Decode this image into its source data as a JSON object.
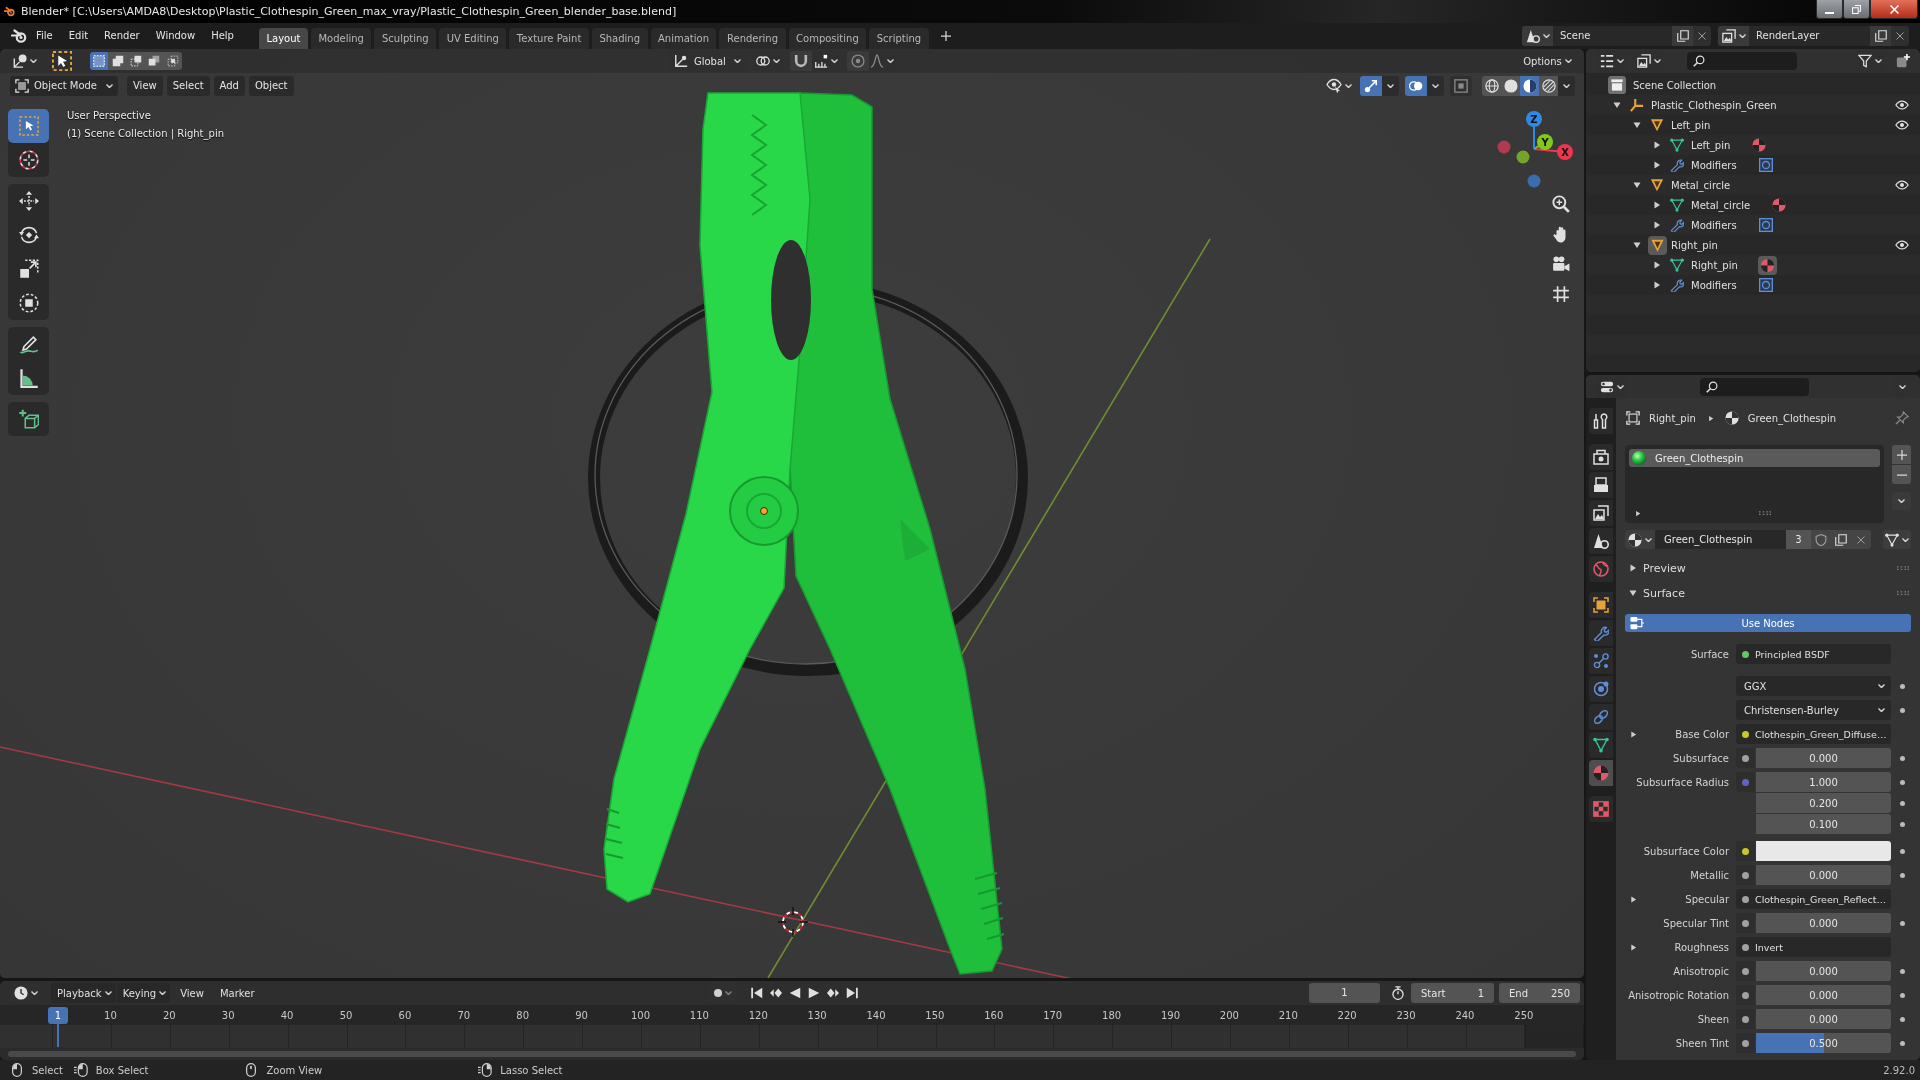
{
  "window": {
    "title": "Blender* [C:\\Users\\AMDA8\\Desktop\\Plastic_Clothespin_Green_max_vray/Plastic_Clothespin_Green_blender_base.blend]"
  },
  "top_bar": {
    "menus": [
      "File",
      "Edit",
      "Render",
      "Window",
      "Help"
    ],
    "workspaces": [
      {
        "label": "Layout",
        "selected": true
      },
      {
        "label": "Modeling",
        "selected": false
      },
      {
        "label": "Sculpting",
        "selected": false
      },
      {
        "label": "UV Editing",
        "selected": false
      },
      {
        "label": "Texture Paint",
        "selected": false
      },
      {
        "label": "Shading",
        "selected": false
      },
      {
        "label": "Animation",
        "selected": false
      },
      {
        "label": "Rendering",
        "selected": false
      },
      {
        "label": "Compositing",
        "selected": false
      },
      {
        "label": "Scripting",
        "selected": false
      }
    ],
    "scene": "Scene",
    "view_layer": "RenderLayer"
  },
  "viewport": {
    "tool_header": {
      "select_modes": [
        {
          "kind": "new",
          "selected": true
        },
        {
          "kind": "extend",
          "selected": false
        },
        {
          "kind": "subtract",
          "selected": false
        },
        {
          "kind": "invert",
          "selected": false
        },
        {
          "kind": "intersect",
          "selected": false
        }
      ],
      "orientation": "Global",
      "snap": {
        "on": false
      },
      "proportional": {
        "on": false
      },
      "options": "Options"
    },
    "header": {
      "mode": "Object Mode",
      "menus": [
        "View",
        "Select",
        "Add",
        "Object"
      ],
      "toggles": [
        {
          "kind": "gizmos",
          "on": true
        },
        {
          "kind": "overlays",
          "on": true
        },
        {
          "kind": "xray",
          "on": false
        }
      ],
      "shading": [
        {
          "kind": "wireframe",
          "selected": false
        },
        {
          "kind": "solid",
          "selected": false
        },
        {
          "kind": "material",
          "selected": true
        },
        {
          "kind": "rendered",
          "selected": false
        }
      ]
    },
    "tool_groups": [
      [
        {
          "kind": "select",
          "selected": true
        },
        {
          "kind": "cursor",
          "selected": false
        }
      ],
      [
        {
          "kind": "move",
          "selected": false
        },
        {
          "kind": "rotate",
          "selected": false
        },
        {
          "kind": "scale",
          "selected": false
        },
        {
          "kind": "transform",
          "selected": false
        }
      ],
      [
        {
          "kind": "annotate",
          "selected": false
        },
        {
          "kind": "measure",
          "selected": false
        }
      ],
      [
        {
          "kind": "add_cube",
          "selected": false
        }
      ]
    ],
    "info": [
      "User Perspective",
      "(1) Scene Collection | Right_pin"
    ],
    "gizmo": {
      "axes": [
        {
          "label": "X",
          "color": "#f0354f"
        },
        {
          "label": "Y",
          "color": "#82c91e"
        },
        {
          "label": "Z",
          "color": "#2f8ae6"
        }
      ],
      "negative_axes": [
        {
          "color": "#b23a50"
        },
        {
          "color": "#74a42a"
        },
        {
          "color": "#3a6cae"
        }
      ]
    }
  },
  "outliner": {
    "items": [
      {
        "name": "Scene Collection",
        "kind": "collection",
        "active": false,
        "children": [
          {
            "name": "Plastic_Clothespin_Green",
            "kind": "empty",
            "expanded": true,
            "visible": true,
            "active": false,
            "children": [
              {
                "name": "Left_pin",
                "kind": "object",
                "expanded": true,
                "visible": true,
                "active": false,
                "children": [
                  {
                    "name": "Left_pin",
                    "kind": "mesh",
                    "expanded": false,
                    "active": false
                  },
                  {
                    "name": "Modifiers",
                    "kind": "modifiers",
                    "expanded": false,
                    "active": false
                  }
                ]
              },
              {
                "name": "Metal_circle",
                "kind": "object",
                "expanded": true,
                "visible": true,
                "active": false,
                "children": [
                  {
                    "name": "Metal_circle",
                    "kind": "mesh",
                    "expanded": false,
                    "active": false
                  },
                  {
                    "name": "Modifiers",
                    "kind": "modifiers",
                    "expanded": false,
                    "active": false
                  }
                ]
              },
              {
                "name": "Right_pin",
                "kind": "object",
                "expanded": true,
                "visible": true,
                "active": true,
                "children": [
                  {
                    "name": "Right_pin",
                    "kind": "mesh",
                    "expanded": false,
                    "active": true
                  },
                  {
                    "name": "Modifiers",
                    "kind": "modifiers",
                    "expanded": false,
                    "active": false
                  }
                ]
              }
            ]
          }
        ]
      }
    ]
  },
  "properties": {
    "tab_groups": [
      [
        {
          "kind": "tool",
          "selected": false
        }
      ],
      [
        {
          "kind": "render",
          "selected": false
        },
        {
          "kind": "output",
          "selected": false
        },
        {
          "kind": "view_layer",
          "selected": false
        },
        {
          "kind": "scene",
          "selected": false
        },
        {
          "kind": "world",
          "selected": false
        }
      ],
      [
        {
          "kind": "object",
          "selected": false
        },
        {
          "kind": "modifiers",
          "selected": false
        },
        {
          "kind": "particles",
          "selected": false
        },
        {
          "kind": "physics",
          "selected": false
        },
        {
          "kind": "constraints",
          "selected": false
        },
        {
          "kind": "data",
          "selected": false
        },
        {
          "kind": "material",
          "selected": true
        }
      ],
      [
        {
          "kind": "texture",
          "selected": false
        }
      ]
    ],
    "breadcrumb": [
      "Right_pin",
      "Green_Clothespin"
    ],
    "material_slots": [
      {
        "name": "Green_Clothespin",
        "selected": true
      }
    ],
    "material": {
      "name": "Green_Clothespin",
      "users": "3"
    },
    "panels": [
      {
        "title": "Preview",
        "expanded": false
      },
      {
        "title": "Surface",
        "expanded": true,
        "use_nodes": {
          "label": "Use Nodes",
          "on": true
        },
        "inputs": [
          {
            "label": "Surface",
            "kind": "link",
            "socket": {
              "color": "#63c763"
            },
            "value": "Principled BSDF"
          },
          {
            "kind": "dropdown",
            "value": "GGX"
          },
          {
            "kind": "dropdown",
            "value": "Christensen-Burley"
          },
          {
            "label": "Base Color",
            "kind": "link",
            "socket": {
              "color": "#c7c729"
            },
            "value": "Clothespin_Green_Diffuse…",
            "expanded": false
          },
          {
            "label": "Subsurface",
            "kind": "slider",
            "socket": {
              "color": "#a1a1a1"
            },
            "value": "0.000",
            "level": 0
          },
          {
            "label": "Subsurface Radius",
            "kind": "vector",
            "socket": {
              "color": "#6363c7"
            },
            "values": [
              "1.000",
              "0.200",
              "0.100"
            ]
          },
          {
            "label": "Subsurface Color",
            "kind": "color",
            "socket": {
              "color": "#c7c729"
            },
            "color": "#e8e8e8"
          },
          {
            "label": "Metallic",
            "kind": "slider",
            "socket": {
              "color": "#a1a1a1"
            },
            "value": "0.000",
            "level": 0
          },
          {
            "label": "Specular",
            "kind": "link",
            "socket": {
              "color": "#a1a1a1"
            },
            "value": "Clothespin_Green_Reflect…",
            "expanded": false
          },
          {
            "label": "Specular Tint",
            "kind": "slider",
            "socket": {
              "color": "#a1a1a1"
            },
            "value": "0.000",
            "level": 0
          },
          {
            "label": "Roughness",
            "kind": "link",
            "socket": {
              "color": "#a1a1a1"
            },
            "value": "Invert",
            "expanded": false
          },
          {
            "label": "Anisotropic",
            "kind": "slider",
            "socket": {
              "color": "#a1a1a1"
            },
            "value": "0.000",
            "level": 0
          },
          {
            "label": "Anisotropic Rotation",
            "kind": "slider",
            "socket": {
              "color": "#a1a1a1"
            },
            "value": "0.000",
            "level": 0
          },
          {
            "label": "Sheen",
            "kind": "slider",
            "socket": {
              "color": "#a1a1a1"
            },
            "value": "0.000",
            "level": 0
          },
          {
            "label": "Sheen Tint",
            "kind": "slider",
            "socket": {
              "color": "#a1a1a1"
            },
            "value": "0.500",
            "level": 0.5
          }
        ]
      }
    ]
  },
  "timeline": {
    "menus": [
      {
        "label": "Playback",
        "kind": "dropdown"
      },
      {
        "label": "Keying",
        "kind": "dropdown"
      },
      {
        "label": "View",
        "kind": "menu"
      },
      {
        "label": "Marker",
        "kind": "menu"
      }
    ],
    "frame": "1",
    "start_label": "Start",
    "start": "1",
    "end_label": "End",
    "end": "250",
    "playhead": "1",
    "ticks": [
      "10",
      "20",
      "30",
      "40",
      "50",
      "60",
      "70",
      "80",
      "90",
      "100",
      "110",
      "120",
      "130",
      "140",
      "150",
      "160",
      "170",
      "180",
      "190",
      "200",
      "210",
      "220",
      "230",
      "240",
      "250"
    ]
  },
  "status_bar": {
    "hints": [
      {
        "kind": "click",
        "label": "Select"
      },
      {
        "kind": "drag",
        "label": "Box Select"
      },
      {
        "kind": "middle",
        "label": "Zoom View"
      },
      {
        "kind": "right_drag",
        "label": "Lasso Select"
      }
    ],
    "version": "2.92.0"
  }
}
